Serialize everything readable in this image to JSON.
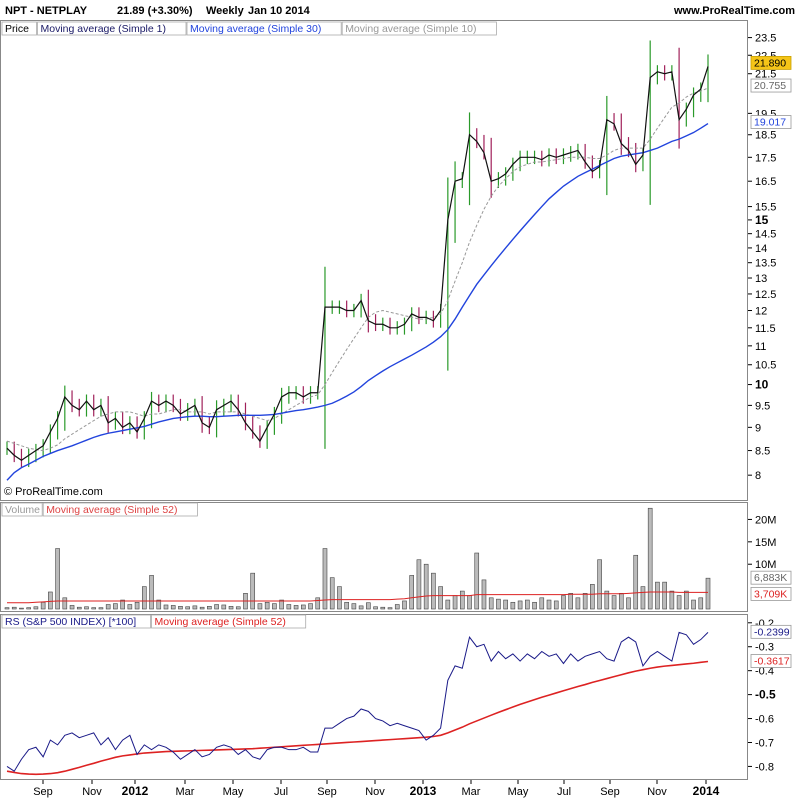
{
  "header": {
    "symbol": "NPT - NETPLAY",
    "price_change": "21.89 (+3.30%)",
    "period": "Weekly",
    "date": "Jan 10 2014",
    "site": "www.ProRealTime.com"
  },
  "copyright": "© ProRealTime.com",
  "price_panel": {
    "legend": [
      {
        "label": "Price",
        "color": "#000000"
      },
      {
        "label": "Moving average (Simple 1)",
        "color": "#1a1a66"
      },
      {
        "label": "Moving average (Simple 30)",
        "color": "#2244dd"
      },
      {
        "label": "Moving average (Simple 10)",
        "color": "#999999"
      }
    ],
    "tags": [
      {
        "text": "21.890",
        "bg": "#f5c518",
        "fg": "#000000"
      },
      {
        "text": "20.755",
        "bg": "#ffffff",
        "fg": "#666666"
      },
      {
        "text": "19.017",
        "bg": "#ffffff",
        "fg": "#2244dd"
      }
    ]
  },
  "volume_panel": {
    "legend": [
      {
        "label": "Volume",
        "color": "#999999"
      },
      {
        "label": "Moving average (Simple 52)",
        "color": "#dd4444"
      }
    ],
    "tags": [
      {
        "text": "6,883K",
        "fg": "#666666"
      },
      {
        "text": "3,709K",
        "fg": "#dd2222"
      }
    ]
  },
  "rs_panel": {
    "legend": [
      {
        "label": "RS (S&P 500 INDEX) [*100]",
        "color": "#1a1a88"
      },
      {
        "label": "Moving average (Simple 52)",
        "color": "#dd2222"
      }
    ],
    "tags": [
      {
        "text": "-0.2399",
        "fg": "#1a1a88"
      },
      {
        "text": "-0.3617",
        "fg": "#dd2222"
      }
    ]
  },
  "chart_data": [
    {
      "type": "candlestick",
      "name": "Price",
      "x_labels": [
        {
          "label": "Sep",
          "bold": false
        },
        {
          "label": "Nov",
          "bold": false
        },
        {
          "label": "2012",
          "bold": true
        },
        {
          "label": "Mar",
          "bold": false
        },
        {
          "label": "May",
          "bold": false
        },
        {
          "label": "Jul",
          "bold": false
        },
        {
          "label": "Sep",
          "bold": false
        },
        {
          "label": "Nov",
          "bold": false
        },
        {
          "label": "2013",
          "bold": true
        },
        {
          "label": "Mar",
          "bold": false
        },
        {
          "label": "May",
          "bold": false
        },
        {
          "label": "Jul",
          "bold": false
        },
        {
          "label": "Sep",
          "bold": false
        },
        {
          "label": "Nov",
          "bold": false
        },
        {
          "label": "2014",
          "bold": true
        }
      ],
      "y_ticks": [
        {
          "v": 8,
          "label": "8",
          "bold": false
        },
        {
          "v": 8.5,
          "label": "8.5",
          "bold": false
        },
        {
          "v": 9,
          "label": "9",
          "bold": false
        },
        {
          "v": 9.5,
          "label": "9.5",
          "bold": false
        },
        {
          "v": 10,
          "label": "10",
          "bold": true
        },
        {
          "v": 10.5,
          "label": "10.5",
          "bold": false
        },
        {
          "v": 11,
          "label": "11",
          "bold": false
        },
        {
          "v": 11.5,
          "label": "11.5",
          "bold": false
        },
        {
          "v": 12,
          "label": "12",
          "bold": false
        },
        {
          "v": 12.5,
          "label": "12.5",
          "bold": false
        },
        {
          "v": 13,
          "label": "13",
          "bold": false
        },
        {
          "v": 13.5,
          "label": "13.5",
          "bold": false
        },
        {
          "v": 14,
          "label": "14",
          "bold": false
        },
        {
          "v": 14.5,
          "label": "14.5",
          "bold": false
        },
        {
          "v": 15,
          "label": "15",
          "bold": true
        },
        {
          "v": 15.5,
          "label": "15.5",
          "bold": false
        },
        {
          "v": 16.5,
          "label": "16.5",
          "bold": false
        },
        {
          "v": 17.5,
          "label": "17.5",
          "bold": false
        },
        {
          "v": 18.5,
          "label": "18.5",
          "bold": false
        },
        {
          "v": 19.5,
          "label": "19.5",
          "bold": false
        },
        {
          "v": 21.5,
          "label": "21.5",
          "bold": false
        },
        {
          "v": 22.5,
          "label": "22.5",
          "bold": false
        },
        {
          "v": 23.5,
          "label": "23.5",
          "bold": false
        }
      ],
      "y_scale": "log",
      "ylim": [
        7.6,
        24.3
      ],
      "close": [
        8.55,
        8.4,
        8.3,
        8.4,
        8.5,
        8.6,
        8.9,
        9.2,
        9.7,
        9.5,
        9.4,
        9.6,
        9.4,
        9.5,
        9.1,
        9.2,
        9.0,
        9.1,
        8.9,
        9.2,
        9.6,
        9.5,
        9.6,
        9.5,
        9.3,
        9.4,
        9.5,
        9.1,
        9.0,
        9.4,
        9.5,
        9.6,
        9.4,
        9.1,
        8.9,
        8.7,
        9.0,
        9.3,
        9.7,
        9.8,
        9.8,
        9.7,
        9.8,
        9.8,
        12.1,
        12.1,
        12.1,
        12.0,
        12.0,
        12.3,
        11.7,
        11.6,
        11.6,
        11.5,
        11.5,
        11.6,
        11.9,
        11.8,
        11.8,
        11.7,
        12.0,
        15.0,
        16.5,
        16.6,
        18.5,
        18.2,
        17.7,
        16.5,
        16.6,
        16.8,
        17.2,
        17.5,
        17.5,
        17.5,
        17.4,
        17.6,
        17.5,
        17.6,
        17.7,
        17.8,
        17.3,
        16.9,
        17.1,
        19.2,
        19.0,
        18.1,
        17.8,
        17.2,
        17.6,
        21.3,
        21.6,
        21.5,
        21.6,
        19.2,
        19.7,
        20.4,
        20.7,
        21.89
      ],
      "series": [
        {
          "name": "Moving average (Simple 30)",
          "values": [
            7.9,
            8.05,
            8.15,
            8.22,
            8.3,
            8.38,
            8.44,
            8.5,
            8.55,
            8.6,
            8.66,
            8.72,
            8.78,
            8.83,
            8.87,
            8.9,
            8.93,
            8.96,
            8.99,
            9.02,
            9.07,
            9.12,
            9.16,
            9.2,
            9.22,
            9.24,
            9.25,
            9.25,
            9.24,
            9.24,
            9.25,
            9.26,
            9.27,
            9.27,
            9.27,
            9.27,
            9.28,
            9.29,
            9.32,
            9.35,
            9.38,
            9.4,
            9.43,
            9.46,
            9.5,
            9.55,
            9.63,
            9.72,
            9.82,
            9.95,
            10.1,
            10.22,
            10.34,
            10.45,
            10.55,
            10.65,
            10.75,
            10.86,
            10.97,
            11.1,
            11.25,
            11.45,
            11.75,
            12.1,
            12.45,
            12.8,
            13.1,
            13.4,
            13.7,
            14.0,
            14.3,
            14.6,
            14.9,
            15.2,
            15.5,
            15.8,
            16.05,
            16.3,
            16.5,
            16.7,
            16.85,
            17.0,
            17.15,
            17.3,
            17.45,
            17.55,
            17.6,
            17.65,
            17.7,
            17.8,
            17.9,
            18.05,
            18.2,
            18.3,
            18.45,
            18.6,
            18.8,
            19.017
          ]
        },
        {
          "name": "Moving average (Simple 10)",
          "values": [
            8.7,
            8.65,
            8.6,
            8.55,
            8.52,
            8.5,
            8.55,
            8.62,
            8.75,
            8.85,
            8.95,
            9.05,
            9.15,
            9.25,
            9.3,
            9.35,
            9.35,
            9.35,
            9.3,
            9.25,
            9.3,
            9.3,
            9.35,
            9.4,
            9.4,
            9.35,
            9.35,
            9.35,
            9.3,
            9.35,
            9.35,
            9.35,
            9.35,
            9.3,
            9.25,
            9.2,
            9.15,
            9.2,
            9.3,
            9.4,
            9.5,
            9.6,
            9.7,
            9.75,
            10.0,
            10.3,
            10.6,
            10.9,
            11.2,
            11.5,
            11.8,
            11.95,
            12.0,
            11.95,
            11.9,
            11.85,
            11.8,
            11.75,
            11.75,
            11.8,
            11.9,
            12.3,
            12.9,
            13.5,
            14.2,
            14.8,
            15.4,
            15.9,
            16.3,
            16.6,
            16.9,
            17.1,
            17.2,
            17.3,
            17.3,
            17.35,
            17.4,
            17.45,
            17.5,
            17.5,
            17.5,
            17.45,
            17.45,
            17.6,
            17.8,
            17.9,
            17.9,
            17.9,
            17.9,
            18.3,
            18.8,
            19.3,
            19.8,
            20.0,
            20.3,
            20.5,
            20.6,
            20.755
          ]
        }
      ]
    },
    {
      "type": "bar",
      "name": "Volume",
      "y_ticks": [
        {
          "v": 10000000,
          "label": "10M",
          "bold": false
        },
        {
          "v": 15000000,
          "label": "15M",
          "bold": false
        },
        {
          "v": 20000000,
          "label": "20M",
          "bold": false
        }
      ],
      "ylim": [
        0,
        23000000
      ],
      "values": [
        300000,
        400000,
        200000,
        300000,
        500000,
        1500000,
        3800000,
        13500000,
        2500000,
        800000,
        400000,
        500000,
        300000,
        300000,
        1000000,
        1200000,
        2000000,
        1000000,
        1500000,
        5000000,
        7500000,
        2000000,
        900000,
        800000,
        600000,
        500000,
        700000,
        400000,
        600000,
        1000000,
        900000,
        600000,
        500000,
        3500000,
        8000000,
        1200000,
        1500000,
        1200000,
        2000000,
        1000000,
        800000,
        900000,
        1200000,
        2500000,
        13500000,
        7000000,
        5000000,
        1500000,
        1200000,
        700000,
        1400000,
        500000,
        400000,
        300000,
        1000000,
        1800000,
        7500000,
        11000000,
        10000000,
        8000000,
        5000000,
        2000000,
        3000000,
        4000000,
        3000000,
        12500000,
        6500000,
        2500000,
        2200000,
        2000000,
        1500000,
        1800000,
        2000000,
        1500000,
        2500000,
        2000000,
        1800000,
        3000000,
        3500000,
        2500000,
        3500000,
        5500000,
        11000000,
        4000000,
        3000000,
        3500000,
        2500000,
        12000000,
        5000000,
        22500000,
        6000000,
        6000000,
        4000000,
        3000000,
        4000000,
        2000000,
        2500000,
        6883000
      ],
      "series": [
        {
          "name": "Moving average (Simple 52)",
          "values": [
            1400000,
            1400000,
            1400000,
            1400000,
            1500000,
            1600000,
            1700000,
            1800000,
            1800000,
            1800000,
            1800000,
            1800000,
            1800000,
            1800000,
            1800000,
            1800000,
            1800000,
            1800000,
            1800000,
            1800000,
            1800000,
            1800000,
            1800000,
            1800000,
            1800000,
            1800000,
            1800000,
            1800000,
            1800000,
            1800000,
            1800000,
            1800000,
            1800000,
            1800000,
            1800000,
            1800000,
            1800000,
            1800000,
            1800000,
            1800000,
            1800000,
            1800000,
            1800000,
            1900000,
            2000000,
            2100000,
            2100000,
            2100000,
            2100000,
            2100000,
            2100000,
            2100000,
            2100000,
            2100000,
            2200000,
            2300000,
            2500000,
            2700000,
            2900000,
            3000000,
            3000000,
            3000000,
            3000000,
            3000000,
            3000000,
            3200000,
            3200000,
            3200000,
            3200000,
            3200000,
            3200000,
            3200000,
            3200000,
            3200000,
            3200000,
            3200000,
            3200000,
            3200000,
            3300000,
            3300000,
            3300000,
            3300000,
            3400000,
            3400000,
            3400000,
            3400000,
            3500000,
            3600000,
            3700000,
            3800000,
            3800000,
            3800000,
            3800000,
            3700000,
            3700000,
            3700000,
            3700000,
            3709000
          ]
        }
      ]
    },
    {
      "type": "line",
      "name": "RS (S&P 500 INDEX) [*100]",
      "y_ticks": [
        {
          "v": -0.8,
          "label": "-0.8",
          "bold": false
        },
        {
          "v": -0.7,
          "label": "-0.7",
          "bold": false
        },
        {
          "v": -0.6,
          "label": "-0.6",
          "bold": false
        },
        {
          "v": -0.5,
          "label": "-0.5",
          "bold": true
        },
        {
          "v": -0.4,
          "label": "-0.4",
          "bold": false
        },
        {
          "v": -0.3,
          "label": "-0.3",
          "bold": false
        },
        {
          "v": -0.2,
          "label": "-0.2",
          "bold": false
        }
      ],
      "ylim": [
        -0.84,
        -0.18
      ],
      "series": [
        {
          "name": "RS (S&P 500 INDEX) [*100]",
          "values": [
            -0.8,
            -0.82,
            -0.77,
            -0.73,
            -0.72,
            -0.76,
            -0.69,
            -0.71,
            -0.67,
            -0.66,
            -0.68,
            -0.67,
            -0.66,
            -0.71,
            -0.68,
            -0.73,
            -0.69,
            -0.67,
            -0.75,
            -0.71,
            -0.73,
            -0.71,
            -0.72,
            -0.74,
            -0.77,
            -0.75,
            -0.73,
            -0.76,
            -0.75,
            -0.72,
            -0.71,
            -0.72,
            -0.75,
            -0.73,
            -0.76,
            -0.77,
            -0.73,
            -0.72,
            -0.72,
            -0.73,
            -0.73,
            -0.72,
            -0.74,
            -0.74,
            -0.64,
            -0.64,
            -0.62,
            -0.6,
            -0.59,
            -0.56,
            -0.57,
            -0.6,
            -0.61,
            -0.63,
            -0.62,
            -0.63,
            -0.64,
            -0.65,
            -0.69,
            -0.67,
            -0.64,
            -0.44,
            -0.38,
            -0.39,
            -0.26,
            -0.3,
            -0.29,
            -0.36,
            -0.32,
            -0.35,
            -0.33,
            -0.36,
            -0.33,
            -0.35,
            -0.32,
            -0.34,
            -0.33,
            -0.37,
            -0.33,
            -0.36,
            -0.34,
            -0.33,
            -0.32,
            -0.35,
            -0.36,
            -0.28,
            -0.26,
            -0.28,
            -0.38,
            -0.34,
            -0.32,
            -0.34,
            -0.36,
            -0.24,
            -0.25,
            -0.29,
            -0.27,
            -0.2399
          ]
        },
        {
          "name": "Moving average (Simple 52)",
          "values": [
            -0.82,
            -0.825,
            -0.83,
            -0.832,
            -0.833,
            -0.832,
            -0.83,
            -0.826,
            -0.82,
            -0.812,
            -0.804,
            -0.795,
            -0.787,
            -0.778,
            -0.77,
            -0.762,
            -0.756,
            -0.752,
            -0.748,
            -0.744,
            -0.742,
            -0.74,
            -0.738,
            -0.737,
            -0.736,
            -0.735,
            -0.734,
            -0.733,
            -0.732,
            -0.731,
            -0.73,
            -0.729,
            -0.728,
            -0.727,
            -0.726,
            -0.724,
            -0.722,
            -0.72,
            -0.718,
            -0.716,
            -0.714,
            -0.712,
            -0.71,
            -0.708,
            -0.706,
            -0.704,
            -0.702,
            -0.7,
            -0.698,
            -0.696,
            -0.694,
            -0.692,
            -0.69,
            -0.688,
            -0.686,
            -0.684,
            -0.682,
            -0.68,
            -0.678,
            -0.675,
            -0.67,
            -0.66,
            -0.648,
            -0.636,
            -0.622,
            -0.61,
            -0.598,
            -0.586,
            -0.574,
            -0.563,
            -0.552,
            -0.541,
            -0.531,
            -0.521,
            -0.511,
            -0.502,
            -0.493,
            -0.484,
            -0.475,
            -0.466,
            -0.458,
            -0.449,
            -0.441,
            -0.433,
            -0.425,
            -0.417,
            -0.409,
            -0.402,
            -0.396,
            -0.39,
            -0.385,
            -0.381,
            -0.378,
            -0.375,
            -0.372,
            -0.369,
            -0.365,
            -0.3617
          ]
        }
      ]
    }
  ]
}
